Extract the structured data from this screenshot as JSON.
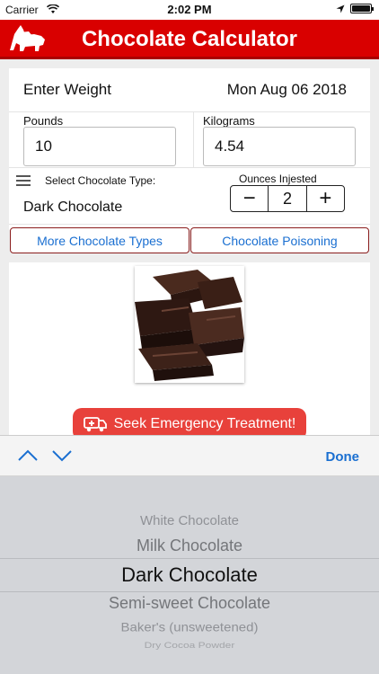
{
  "status_bar": {
    "carrier": "Carrier",
    "time": "2:02 PM"
  },
  "header": {
    "title": "Chocolate Calculator"
  },
  "weight": {
    "label": "Enter Weight",
    "date": "Mon Aug 06 2018",
    "pounds_label": "Pounds",
    "pounds_value": "10",
    "kilograms_label": "Kilograms",
    "kilograms_value": "4.54"
  },
  "chocolate": {
    "select_label": "Select Chocolate Type:",
    "selected": "Dark Chocolate"
  },
  "ounces": {
    "label": "Ounces Injested",
    "value": "2",
    "minus": "−",
    "plus": "+"
  },
  "buttons": {
    "more_types": "More Chocolate Types",
    "poisoning": "Chocolate Poisoning",
    "emergency": "Seek Emergency Treatment!"
  },
  "toolbar": {
    "done": "Done"
  },
  "picker": {
    "options": [
      "White Chocolate",
      "Milk Chocolate",
      "Dark Chocolate",
      "Semi-sweet Chocolate",
      "Baker's (unsweetened)",
      "Dry Cocoa Powder"
    ]
  },
  "colors": {
    "brand_red": "#d90000",
    "link_blue": "#1a6fd1",
    "emergency_red": "#e8413b"
  }
}
